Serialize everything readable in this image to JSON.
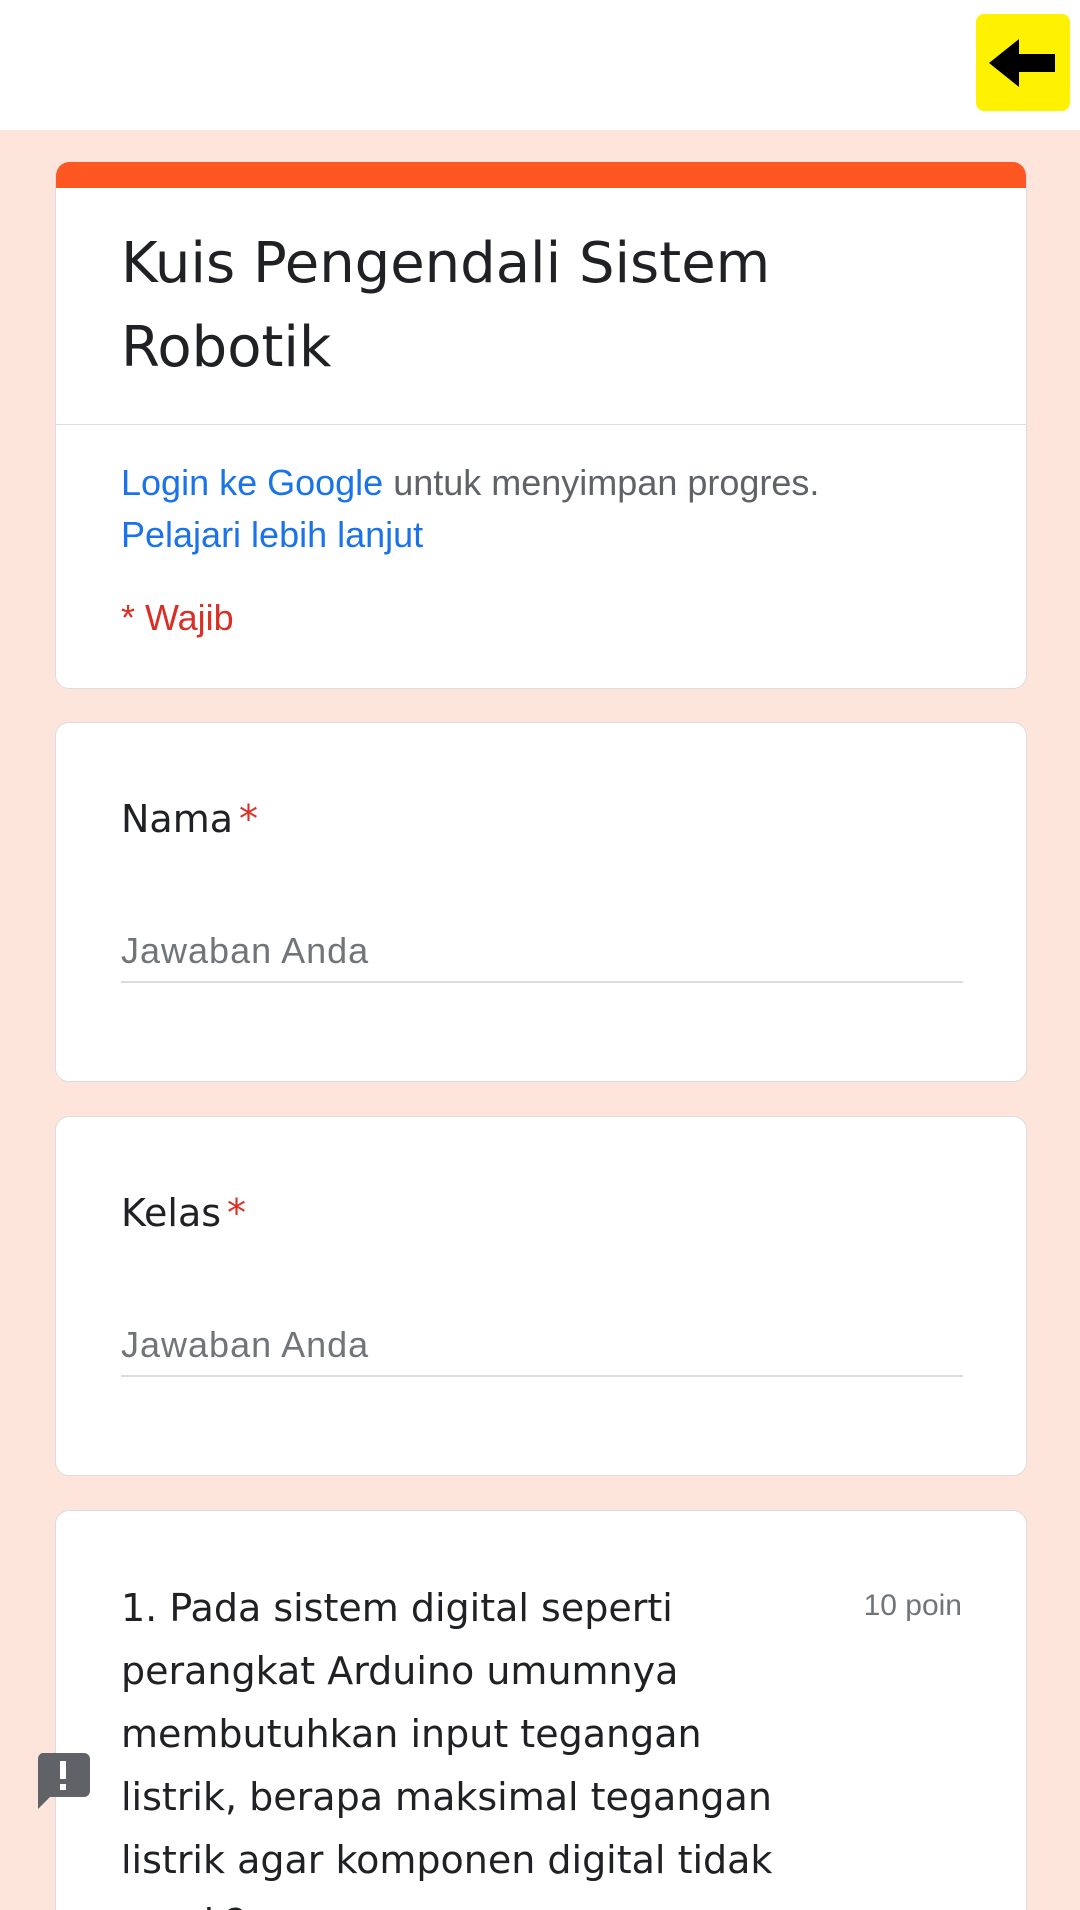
{
  "form": {
    "title": "Kuis Pengendali Sistem Robotik",
    "login_link": "Login ke Google",
    "login_suffix": " untuk menyimpan progres.",
    "learn_more": "Pelajari lebih lanjut",
    "required_note": "* Wajib"
  },
  "questions": {
    "name": {
      "label": "Nama",
      "required_mark": "*",
      "placeholder": "Jawaban Anda"
    },
    "kelas": {
      "label": "Kelas",
      "required_mark": "*",
      "placeholder": "Jawaban Anda"
    },
    "q1": {
      "text": "1. Pada sistem digital seperti perangkat Arduino umumnya membutuhkan input tegangan listrik, berapa maksimal tegangan listrik agar komponen digital tidak rusak?",
      "points": "10 poin"
    }
  },
  "colors": {
    "accent": "#ff5722",
    "background": "#fde5dc",
    "link": "#1a73e8",
    "required": "#d93025",
    "back_button": "#fff200"
  },
  "icons": {
    "back": "arrow-left-icon",
    "feedback": "feedback-icon"
  }
}
